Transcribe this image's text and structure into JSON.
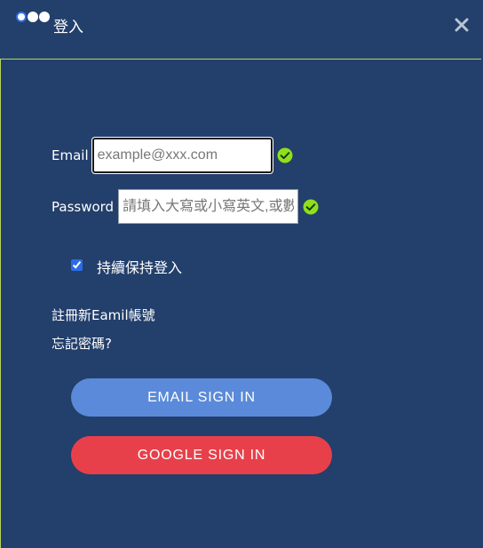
{
  "window": {
    "title": "登入",
    "close_icon": "close-icon"
  },
  "form": {
    "email": {
      "label": "Email",
      "placeholder": "example@xxx.com",
      "value": "",
      "status_icon": "check-circle-icon"
    },
    "password": {
      "label": "Password",
      "placeholder": "請填入大寫或小寫英文,或數字",
      "value": "",
      "status_icon": "check-circle-icon"
    },
    "remember": {
      "label": "持續保持登入",
      "checked": true
    },
    "links": {
      "register": "註冊新Eamil帳號",
      "forgot": "忘記密碼?"
    },
    "buttons": {
      "email_sign_in": "EMAIL SIGN IN",
      "google_sign_in": "GOOGLE SIGN IN"
    }
  },
  "colors": {
    "background": "#233f6b",
    "accent_border": "#b6d75a",
    "valid_check": "#8fe01a",
    "email_button": "#5a8ad9",
    "google_button": "#e8404a"
  }
}
